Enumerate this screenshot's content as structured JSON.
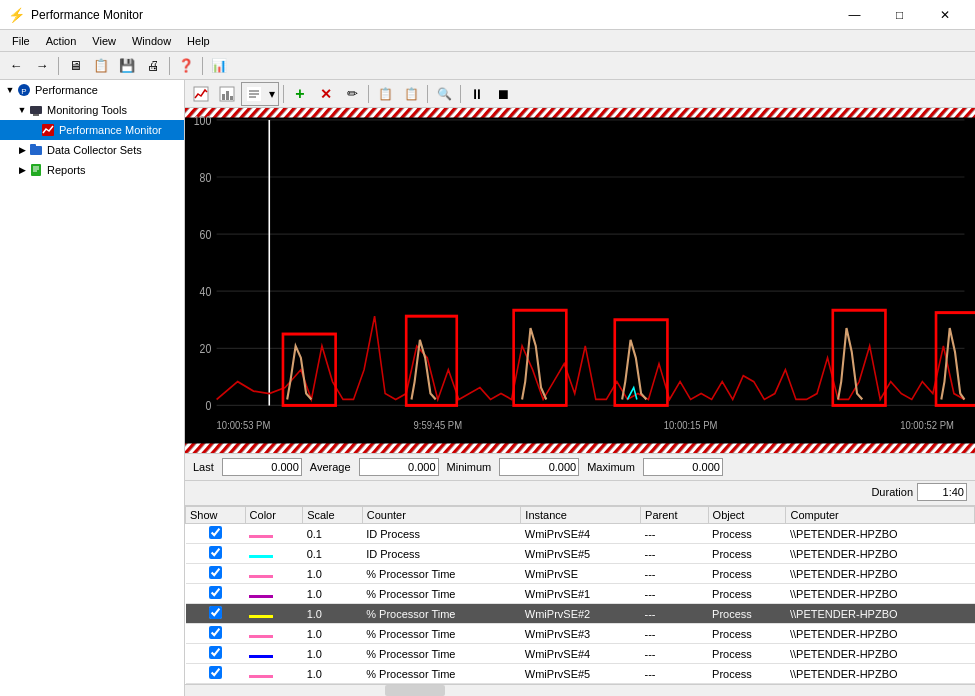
{
  "window": {
    "title": "Performance Monitor",
    "title_icon": "⚡"
  },
  "menu": {
    "items": [
      "File",
      "Action",
      "View",
      "Window",
      "Help"
    ]
  },
  "toolbar_main": {
    "buttons": [
      "←",
      "→",
      "🖥",
      "📋",
      "💾",
      "🖨",
      "❓",
      "📊"
    ]
  },
  "sidebar": {
    "items": [
      {
        "id": "performance",
        "label": "Performance",
        "level": 0,
        "icon": "perf",
        "expanded": true
      },
      {
        "id": "monitoring-tools",
        "label": "Monitoring Tools",
        "level": 1,
        "icon": "monitor",
        "expanded": true
      },
      {
        "id": "performance-monitor",
        "label": "Performance Monitor",
        "level": 2,
        "icon": "pm",
        "selected": true
      },
      {
        "id": "data-collector-sets",
        "label": "Data Collector Sets",
        "level": 1,
        "icon": "dcs",
        "expanded": false
      },
      {
        "id": "reports",
        "label": "Reports",
        "level": 1,
        "icon": "reports",
        "expanded": false
      }
    ]
  },
  "perfmon_toolbar": {
    "buttons": [
      {
        "label": "📊",
        "name": "graph-view"
      },
      {
        "label": "📋",
        "name": "report-view"
      },
      {
        "label": "▼",
        "name": "view-dropdown"
      },
      {
        "label": "➕",
        "name": "add-counter"
      },
      {
        "label": "✕",
        "name": "delete-counter"
      },
      {
        "label": "✏",
        "name": "properties"
      },
      {
        "label": "📋",
        "name": "copy"
      },
      {
        "label": "📋",
        "name": "paste"
      },
      {
        "label": "🔍",
        "name": "search"
      },
      {
        "label": "⏸",
        "name": "freeze"
      },
      {
        "label": "⏹",
        "name": "stop"
      }
    ]
  },
  "chart": {
    "y_labels": [
      "100",
      "80",
      "60",
      "40",
      "20",
      "0"
    ],
    "x_labels": [
      "10:00:53 PM",
      "9:59:45 PM",
      "10:00:15 PM",
      "10:00:52 PM"
    ],
    "background_color": "#000000",
    "grid_color": "#1a1a1a"
  },
  "stats": {
    "last_label": "Last",
    "last_value": "0.000",
    "average_label": "Average",
    "average_value": "0.000",
    "minimum_label": "Minimum",
    "minimum_value": "0.000",
    "maximum_label": "Maximum",
    "maximum_value": "0.000",
    "duration_label": "Duration",
    "duration_value": "1:40"
  },
  "table": {
    "headers": [
      "Show",
      "Color",
      "Scale",
      "Counter",
      "Instance",
      "Parent",
      "Object",
      "Computer"
    ],
    "rows": [
      {
        "show": true,
        "color": "#ff69b4",
        "scale": "0.1",
        "counter": "ID Process",
        "instance": "WmiPrvSE#4",
        "parent": "---",
        "object": "Process",
        "computer": "\\\\PETENDER-HPZBO",
        "selected": false
      },
      {
        "show": true,
        "color": "#00ffff",
        "scale": "0.1",
        "counter": "ID Process",
        "instance": "WmiPrvSE#5",
        "parent": "---",
        "object": "Process",
        "computer": "\\\\PETENDER-HPZBO",
        "selected": false
      },
      {
        "show": true,
        "color": "#ff69b4",
        "scale": "1.0",
        "counter": "% Processor Time",
        "instance": "WmiPrvSE",
        "parent": "---",
        "object": "Process",
        "computer": "\\\\PETENDER-HPZBO",
        "selected": false
      },
      {
        "show": true,
        "color": "#aa00aa",
        "scale": "1.0",
        "counter": "% Processor Time",
        "instance": "WmiPrvSE#1",
        "parent": "---",
        "object": "Process",
        "computer": "\\\\PETENDER-HPZBO",
        "selected": false
      },
      {
        "show": true,
        "color": "#ffff00",
        "scale": "1.0",
        "counter": "% Processor Time",
        "instance": "WmiPrvSE#2",
        "parent": "---",
        "object": "Process",
        "computer": "\\\\PETENDER-HPZBO",
        "selected": true
      },
      {
        "show": true,
        "color": "#ff69b4",
        "scale": "1.0",
        "counter": "% Processor Time",
        "instance": "WmiPrvSE#3",
        "parent": "---",
        "object": "Process",
        "computer": "\\\\PETENDER-HPZBO",
        "selected": false
      },
      {
        "show": true,
        "color": "#0000ff",
        "scale": "1.0",
        "counter": "% Processor Time",
        "instance": "WmiPrvSE#4",
        "parent": "---",
        "object": "Process",
        "computer": "\\\\PETENDER-HPZBO",
        "selected": false
      },
      {
        "show": true,
        "color": "#ff69b4",
        "scale": "1.0",
        "counter": "% Processor Time",
        "instance": "WmiPrvSE#5",
        "parent": "---",
        "object": "Process",
        "computer": "\\\\PETENDER-HPZBO",
        "selected": false
      }
    ]
  }
}
